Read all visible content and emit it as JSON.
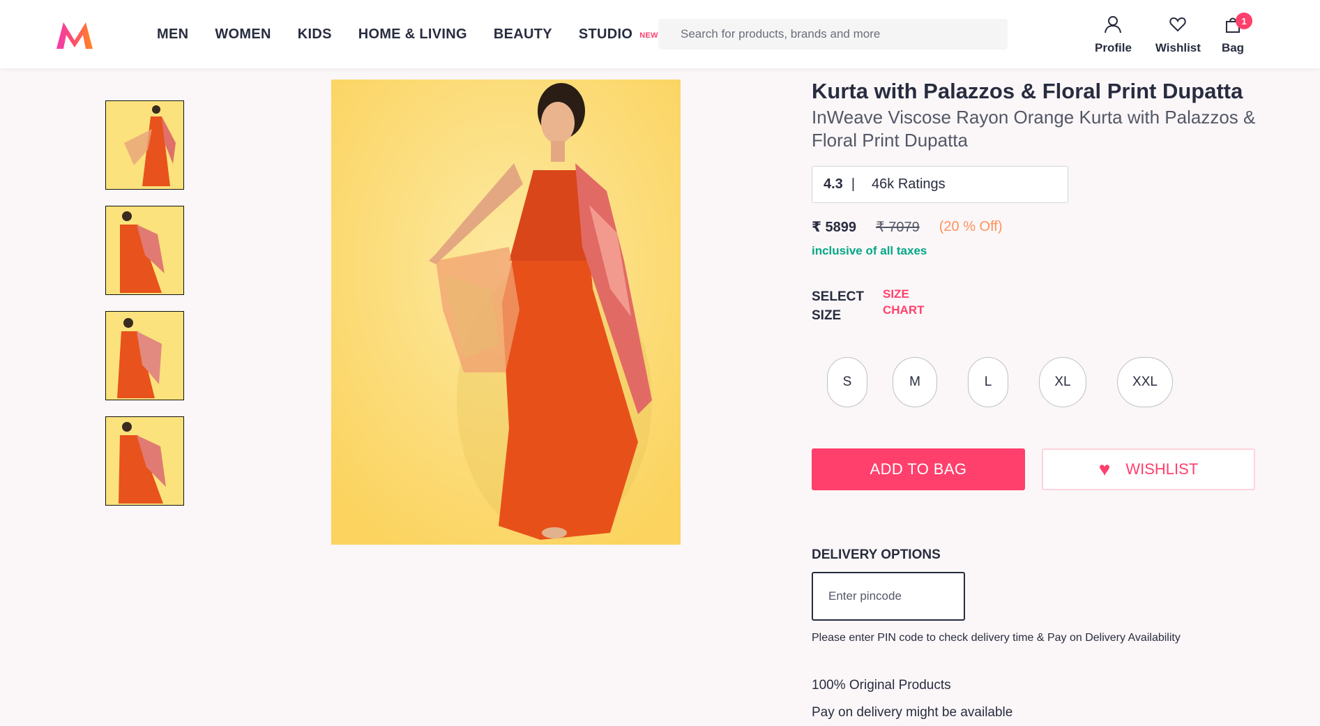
{
  "header": {
    "nav": [
      {
        "label": "MEN"
      },
      {
        "label": "WOMEN"
      },
      {
        "label": "KIDS"
      },
      {
        "label": "HOME & LIVING"
      },
      {
        "label": "BEAUTY"
      },
      {
        "label": "STUDIO",
        "tag": "NEW"
      }
    ],
    "search_placeholder": "Search for products, brands and more",
    "actions": {
      "profile": "Profile",
      "wishlist": "Wishlist",
      "bag": "Bag",
      "bag_count": "1"
    }
  },
  "gallery": {
    "thumbnail_count": 4
  },
  "product": {
    "brand_line": "Kurta with Palazzos & Floral Print Dupatta",
    "name": "InWeave Viscose Rayon Orange Kurta with Palazzos & Floral Print Dupatta",
    "rating": "4.3",
    "rating_sep": "|",
    "rating_count": "46k Ratings",
    "price": "₹ 5899",
    "mrp": "₹ 7079",
    "discount": "(20 % Off)",
    "tax_note": "inclusive of all taxes"
  },
  "size": {
    "select_label": "SELECT SIZE",
    "chart_label": "SIZE CHART",
    "options": [
      "S",
      "M",
      "L",
      "XL",
      "XXL"
    ]
  },
  "cta": {
    "add_to_bag": "ADD TO BAG",
    "wishlist": "WISHLIST"
  },
  "delivery": {
    "title": "DELIVERY OPTIONS",
    "pincode_placeholder": "Enter pincode",
    "note": "Please enter PIN code to check delivery time & Pay on Delivery Availability",
    "promises": [
      "100% Original Products",
      "Pay on delivery might be available"
    ]
  },
  "colors": {
    "accent": "#ff3f6c",
    "discount": "#ff905a",
    "tax": "#03a685"
  }
}
